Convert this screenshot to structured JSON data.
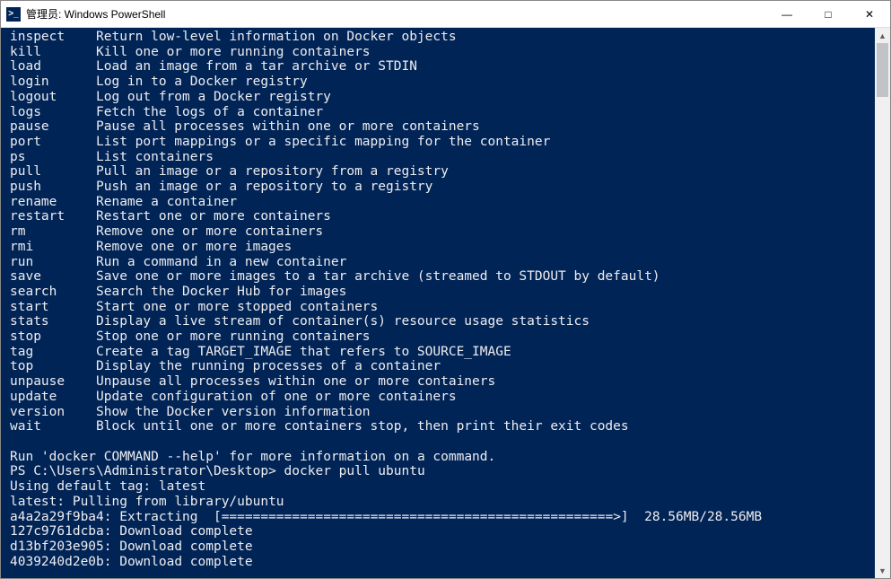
{
  "window": {
    "title": "管理员: Windows PowerShell",
    "icon_glyph": ">_"
  },
  "commands": [
    {
      "name": "inspect",
      "desc": "Return low-level information on Docker objects"
    },
    {
      "name": "kill",
      "desc": "Kill one or more running containers"
    },
    {
      "name": "load",
      "desc": "Load an image from a tar archive or STDIN"
    },
    {
      "name": "login",
      "desc": "Log in to a Docker registry"
    },
    {
      "name": "logout",
      "desc": "Log out from a Docker registry"
    },
    {
      "name": "logs",
      "desc": "Fetch the logs of a container"
    },
    {
      "name": "pause",
      "desc": "Pause all processes within one or more containers"
    },
    {
      "name": "port",
      "desc": "List port mappings or a specific mapping for the container"
    },
    {
      "name": "ps",
      "desc": "List containers"
    },
    {
      "name": "pull",
      "desc": "Pull an image or a repository from a registry"
    },
    {
      "name": "push",
      "desc": "Push an image or a repository to a registry"
    },
    {
      "name": "rename",
      "desc": "Rename a container"
    },
    {
      "name": "restart",
      "desc": "Restart one or more containers"
    },
    {
      "name": "rm",
      "desc": "Remove one or more containers"
    },
    {
      "name": "rmi",
      "desc": "Remove one or more images"
    },
    {
      "name": "run",
      "desc": "Run a command in a new container"
    },
    {
      "name": "save",
      "desc": "Save one or more images to a tar archive (streamed to STDOUT by default)"
    },
    {
      "name": "search",
      "desc": "Search the Docker Hub for images"
    },
    {
      "name": "start",
      "desc": "Start one or more stopped containers"
    },
    {
      "name": "stats",
      "desc": "Display a live stream of container(s) resource usage statistics"
    },
    {
      "name": "stop",
      "desc": "Stop one or more running containers"
    },
    {
      "name": "tag",
      "desc": "Create a tag TARGET_IMAGE that refers to SOURCE_IMAGE"
    },
    {
      "name": "top",
      "desc": "Display the running processes of a container"
    },
    {
      "name": "unpause",
      "desc": "Unpause all processes within one or more containers"
    },
    {
      "name": "update",
      "desc": "Update configuration of one or more containers"
    },
    {
      "name": "version",
      "desc": "Show the Docker version information"
    },
    {
      "name": "wait",
      "desc": "Block until one or more containers stop, then print their exit codes"
    }
  ],
  "footer": {
    "help_line": "Run 'docker COMMAND --help' for more information on a command.",
    "prompt": "PS C:\\Users\\Administrator\\Desktop>",
    "typed_command": "docker pull ubuntu",
    "out1": "Using default tag: latest",
    "out2": "latest: Pulling from library/ubuntu",
    "layer1_id": "a4a2a29f9ba4:",
    "layer1_status": "Extracting",
    "layer1_bar": "[==================================================>]",
    "layer1_size": "28.56MB/28.56MB",
    "layer2": "127c9761dcba: Download complete",
    "layer3": "d13bf203e905: Download complete",
    "layer4": "4039240d2e0b: Download complete"
  }
}
